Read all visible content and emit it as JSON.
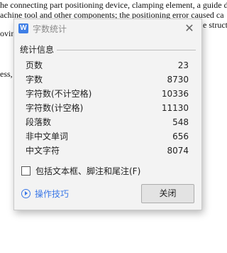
{
  "background_document": {
    "lines": [
      "he connecting part positioning device, clamping element, a guide d",
      "achine tool and other components; the positioning error caused ca",
      "oving",
      "e struct",
      "ess, p"
    ]
  },
  "dialog": {
    "app_icon_letter": "W",
    "title": "字数统计",
    "close_glyph": "✕",
    "section_title": "统计信息",
    "stats": [
      {
        "label": "页数",
        "value": "23"
      },
      {
        "label": "字数",
        "value": "8730"
      },
      {
        "label": "字符数(不计空格)",
        "value": "10336"
      },
      {
        "label": "字符数(计空格)",
        "value": "11130"
      },
      {
        "label": "段落数",
        "value": "548"
      },
      {
        "label": "非中文单词",
        "value": "656"
      },
      {
        "label": "中文字符",
        "value": "8074"
      }
    ],
    "checkbox_label": "包括文本框、脚注和尾注(F)",
    "checkbox_checked": false,
    "tips_label": "操作技巧",
    "close_button_label": "关闭"
  },
  "colors": {
    "accent": "#3b78e7",
    "app_icon": "#3f7fe6",
    "dialog_background": "#f3f3f3"
  }
}
